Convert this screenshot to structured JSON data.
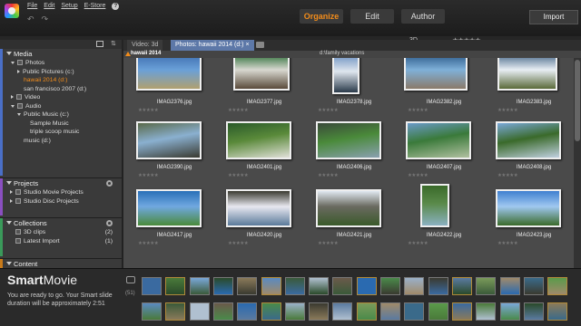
{
  "menu": [
    "File",
    "Edit",
    "Setup",
    "E-Store"
  ],
  "undo_icon": "undo-icon",
  "redo_icon": "redo-icon",
  "modes": [
    {
      "label": "Organize",
      "active": true
    },
    {
      "label": "Edit",
      "active": false
    },
    {
      "label": "Author",
      "active": false
    }
  ],
  "import_label": "Import",
  "toolbar": {
    "view_3d": "3D",
    "rating": "★★★★★"
  },
  "sidebar": {
    "media": {
      "title": "Media",
      "items": [
        {
          "label": "Photos",
          "indent": 1,
          "type": "folder-open"
        },
        {
          "label": "Public Pictures (c:)",
          "indent": 2,
          "type": "caret"
        },
        {
          "label": "hawaii 2014 (d:)",
          "indent": 3,
          "type": "none",
          "selected": true
        },
        {
          "label": "san francisco 2007 (d:)",
          "indent": 3,
          "type": "none"
        },
        {
          "label": "Video",
          "indent": 1,
          "type": "folder-closed"
        },
        {
          "label": "Audio",
          "indent": 1,
          "type": "folder-open"
        },
        {
          "label": "Public Music (c:)",
          "indent": 2,
          "type": "caret-down"
        },
        {
          "label": "Sample Music",
          "indent": 4,
          "type": "none"
        },
        {
          "label": "triple scoop music",
          "indent": 4,
          "type": "none"
        },
        {
          "label": "music (d:)",
          "indent": 3,
          "type": "none"
        }
      ]
    },
    "projects": {
      "title": "Projects",
      "items": [
        "Studio Movie Projects",
        "Studio Disc Projects"
      ]
    },
    "collections": {
      "title": "Collections",
      "items": [
        {
          "label": "3D clips",
          "count": "(2)"
        },
        {
          "label": "Latest Import",
          "count": "(1)"
        }
      ]
    },
    "content": {
      "title": "Content"
    }
  },
  "tabs": [
    {
      "label": "Video: 3d",
      "active": false
    },
    {
      "label": "Photos: hawaii 2014 (d:)",
      "active": true
    }
  ],
  "tab_close": "×",
  "breadcrumb": {
    "left": "hawaii 2014",
    "right": "d:\\family vacations"
  },
  "grid": {
    "stars": "★★★★★",
    "rows": [
      [
        "IMAG2376.jpg",
        "IMAG2377.jpg",
        "IMAG2378.jpg",
        "IMAG2382.jpg",
        "IMAG2383.jpg"
      ],
      [
        "IMAG2390.jpg",
        "IMAG2401.jpg",
        "IMAG2406.jpg",
        "IMAG2407.jpg",
        "IMAG2408.jpg"
      ],
      [
        "IMAG2417.jpg",
        "IMAG2420.jpg",
        "IMAG2421.jpg",
        "IMAG2422.jpg",
        "IMAG2423.jpg"
      ]
    ]
  },
  "smartmovie": {
    "title_a": "Smart",
    "title_b": "Movie",
    "message": "You are ready to go. Your Smart slide duration will be approximately 2:51",
    "count": "(51)"
  }
}
